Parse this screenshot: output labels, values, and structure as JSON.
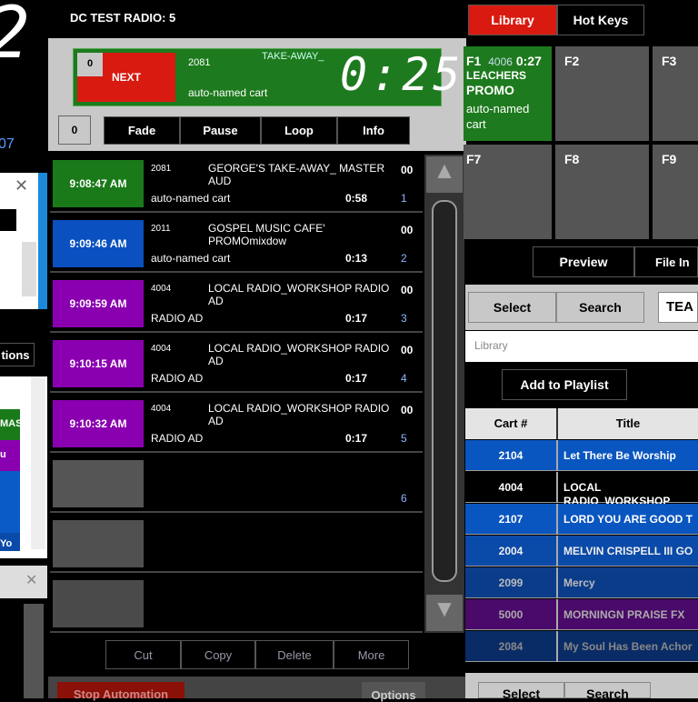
{
  "left": {
    "clock_digit": "2",
    "date_fragment": "07",
    "options_fragment": "tions",
    "row_fragments": [
      "MAS",
      "u",
      "",
      "",
      "Yo"
    ],
    "colors": [
      "#1a7a1a",
      "#8a00b0",
      "#0a5ac8",
      "#0a5ac8",
      "#0a4aa8"
    ]
  },
  "header": {
    "title": "DC TEST RADIO: 5"
  },
  "now_playing": {
    "next_count": "0",
    "next_label": "NEXT",
    "cart": "2081",
    "title": "TAKE-AWAY_",
    "subtitle": "auto-named cart",
    "countdown": "0:25"
  },
  "controls": {
    "counter": "0",
    "buttons": [
      "Fade",
      "Pause",
      "Loop",
      "Info"
    ]
  },
  "playlist": [
    {
      "time": "9:08:47 AM",
      "color": "#1a7a1a",
      "cart": "2081",
      "title": "GEORGE'S TAKE-AWAY_ MASTER AUD",
      "sub": "auto-named cart",
      "dur": "0:58",
      "oo": "00",
      "num": "1"
    },
    {
      "time": "9:09:46 AM",
      "color": "#0a50c0",
      "cart": "2011",
      "title": "GOSPEL MUSIC CAFE' PROMOmixdow",
      "sub": "auto-named cart",
      "dur": "0:13",
      "oo": "00",
      "num": "2"
    },
    {
      "time": "9:09:59 AM",
      "color": "#8a00b0",
      "cart": "4004",
      "title": "LOCAL RADIO_WORKSHOP RADIO AD",
      "sub": "RADIO AD",
      "dur": "0:17",
      "oo": "00",
      "num": "3"
    },
    {
      "time": "9:10:15 AM",
      "color": "#8a00b0",
      "cart": "4004",
      "title": "LOCAL RADIO_WORKSHOP RADIO AD",
      "sub": "RADIO AD",
      "dur": "0:17",
      "oo": "00",
      "num": "4"
    },
    {
      "time": "9:10:32 AM",
      "color": "#8a00b0",
      "cart": "4004",
      "title": "LOCAL RADIO_WORKSHOP RADIO AD",
      "sub": "RADIO AD",
      "dur": "0:17",
      "oo": "00",
      "num": "5"
    },
    {
      "time": "",
      "color": "#555",
      "cart": "",
      "title": "",
      "sub": "",
      "dur": "",
      "oo": "",
      "num": "6"
    },
    {
      "time": "",
      "color": "#505050",
      "cart": "",
      "title": "",
      "sub": "",
      "dur": "",
      "oo": "",
      "num": ""
    },
    {
      "time": "",
      "color": "#4a4a4a",
      "cart": "",
      "title": "",
      "sub": "",
      "dur": "",
      "oo": "",
      "num": ""
    }
  ],
  "edit_buttons": [
    "Cut",
    "Copy",
    "Delete",
    "More"
  ],
  "footer": {
    "stop": "Stop Automation",
    "options": "Options"
  },
  "tabs": {
    "library": "Library",
    "hotkeys": "Hot Keys"
  },
  "hotkeys": [
    {
      "key": "F1",
      "cart": "4006",
      "dur": "0:27",
      "title_fragment": "LEACHERS",
      "title2": "PROMO",
      "sub": "auto-named cart"
    },
    {
      "key": "F2"
    },
    {
      "key": "F3"
    },
    {
      "key": "F7"
    },
    {
      "key": "F8"
    },
    {
      "key": "F9"
    }
  ],
  "library": {
    "preview": "Preview",
    "file_info": "File In",
    "select": "Select",
    "search": "Search",
    "search_value": "TEA",
    "placeholder": "Library",
    "add": "Add to Playlist",
    "col_cart": "Cart #",
    "col_title": "Title",
    "rows": [
      {
        "cart": "2104",
        "title": "Let There Be Worship",
        "color": "#0a56c0",
        "fg": "#fff"
      },
      {
        "cart": "4004",
        "title": "LOCAL RADIO_WORKSHOP",
        "color": "#000",
        "fg": "#fff"
      },
      {
        "cart": "2107",
        "title": "LORD YOU ARE GOOD T",
        "color": "#0a56c0",
        "fg": "#fff"
      },
      {
        "cart": "2004",
        "title": "MELVIN CRISPELL III  GO",
        "color": "#0a4aa8",
        "fg": "#eee"
      },
      {
        "cart": "2099",
        "title": "Mercy",
        "color": "#0a3c8a",
        "fg": "#bbb"
      },
      {
        "cart": "5000",
        "title": "MORNINGN PRAISE FX",
        "color": "#4a0a6a",
        "fg": "#aaa"
      },
      {
        "cart": "2084",
        "title": "My Soul Has Been Achor",
        "color": "#0a2c66",
        "fg": "#888"
      }
    ],
    "bottom_select": "Select",
    "bottom_search": "Search"
  }
}
